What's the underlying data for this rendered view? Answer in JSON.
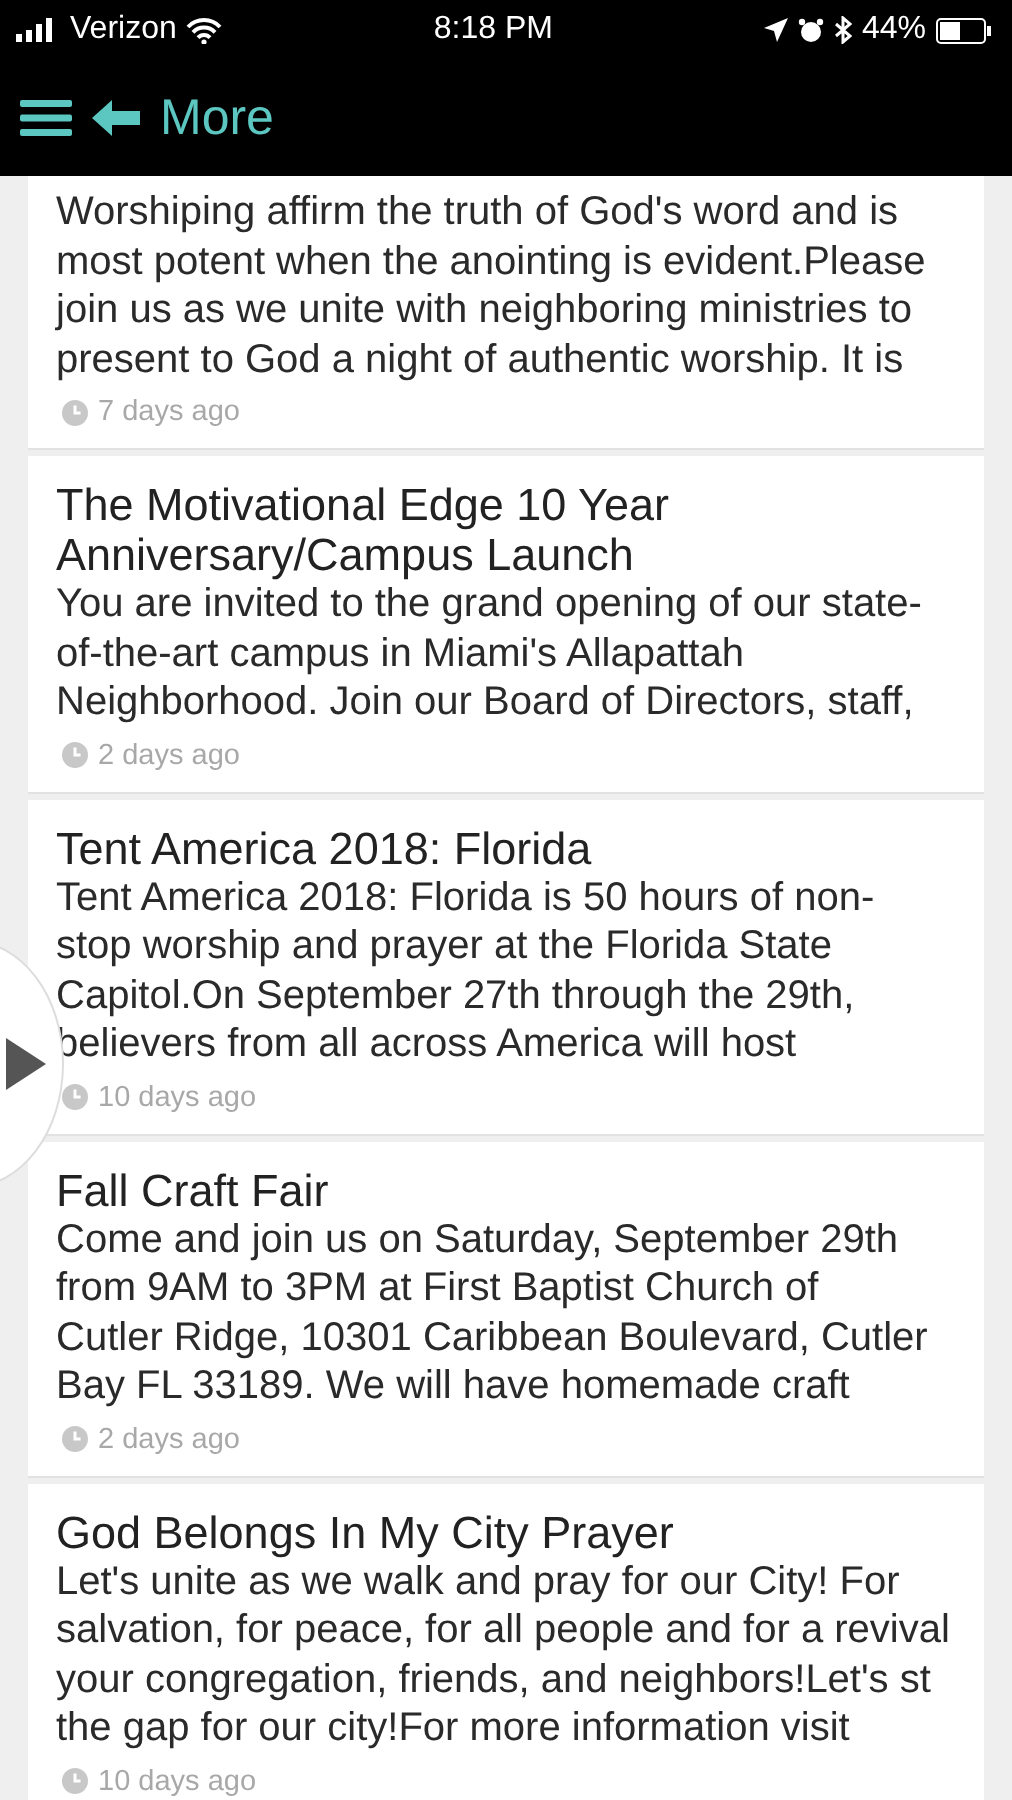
{
  "status_bar": {
    "carrier": "Verizon",
    "time": "8:18 PM",
    "battery": "44%"
  },
  "header": {
    "title": "More"
  },
  "posts": [
    {
      "body_lines": [
        "Worshiping affirm the truth of God's word and is",
        "most potent when the anointing is evident.Please",
        "join us as we unite with neighboring ministries to",
        "present to God a night of authentic worship. It is"
      ],
      "time": "7 days ago"
    },
    {
      "title_lines": [
        "The Motivational Edge 10 Year",
        "Anniversary/Campus Launch"
      ],
      "body_lines": [
        "You are invited to the grand opening of our state-",
        "of-the-art campus in Miami's Allapattah",
        "Neighborhood. Join our Board of Directors, staff,"
      ],
      "time": "2 days ago"
    },
    {
      "title_lines": [
        "Tent America 2018: Florida"
      ],
      "body_lines": [
        "Tent America 2018: Florida is 50 hours of non-",
        "stop worship and prayer at the Florida State",
        "Capitol.On September 27th through the 29th,",
        "believers from all across America will host"
      ],
      "time": "10 days ago"
    },
    {
      "title_lines": [
        "Fall Craft Fair"
      ],
      "body_lines": [
        "Come and join us on Saturday, September 29th",
        "from 9AM to 3PM at First Baptist Church of",
        "Cutler Ridge, 10301 Caribbean Boulevard, Cutler",
        "Bay FL 33189. We will have homemade craft"
      ],
      "time": "2 days ago"
    },
    {
      "title_lines": [
        "God Belongs In My City Prayer"
      ],
      "body_lines": [
        "Let's unite as we walk and pray for our City! For",
        "salvation, for peace, for all people and for a revival",
        "your congregation, friends, and neighbors!Let's st",
        "the gap for our city!For more information visit"
      ],
      "time": "10 days ago"
    }
  ]
}
